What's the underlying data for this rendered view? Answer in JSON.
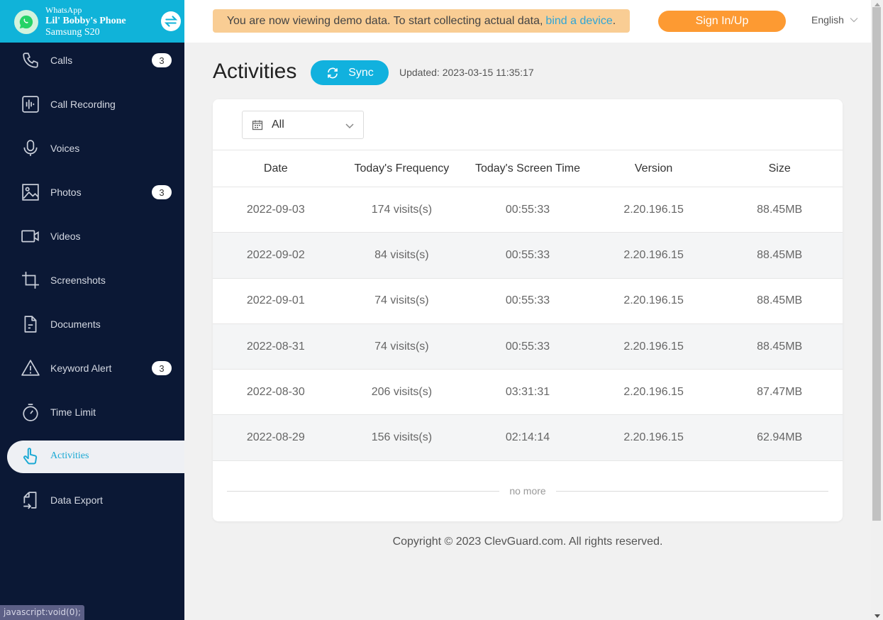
{
  "device": {
    "app": "WhatsApp",
    "name": "Lil' Bobby's Phone",
    "model": "Samsung S20",
    "accent_color": "#10b3d9"
  },
  "sidebar": {
    "items": [
      {
        "label": "Calls",
        "icon": "phone-icon",
        "badge": "3"
      },
      {
        "label": "Call Recording",
        "icon": "call-recording-icon",
        "badge": null
      },
      {
        "label": "Voices",
        "icon": "microphone-icon",
        "badge": null
      },
      {
        "label": "Photos",
        "icon": "photo-icon",
        "badge": "3"
      },
      {
        "label": "Videos",
        "icon": "video-camera-icon",
        "badge": null
      },
      {
        "label": "Screenshots",
        "icon": "crop-icon",
        "badge": null
      },
      {
        "label": "Documents",
        "icon": "document-icon",
        "badge": null
      },
      {
        "label": "Keyword Alert",
        "icon": "warning-icon",
        "badge": "3"
      },
      {
        "label": "Time Limit",
        "icon": "stopwatch-icon",
        "badge": null
      },
      {
        "label": "Activities",
        "icon": "hand-pointer-icon",
        "badge": null,
        "active": true
      },
      {
        "label": "Data Export",
        "icon": "export-icon",
        "badge": null
      }
    ],
    "status_tooltip": "javascript:void(0);"
  },
  "topbar": {
    "banner_text": "You are now viewing demo data. To start collecting actual data,",
    "banner_link": "bind a device",
    "banner_suffix": ".",
    "signin_label": "Sign In/Up",
    "language": "English"
  },
  "main": {
    "title": "Activities",
    "sync_label": "Sync",
    "updated": "Updated: 2023-03-15 11:35:17",
    "filter_value": "All",
    "columns": [
      "Date",
      "Today's Frequency",
      "Today's Screen Time",
      "Version",
      "Size"
    ],
    "rows": [
      [
        "2022-09-03",
        "174 visits(s)",
        "00:55:33",
        "2.20.196.15",
        "88.45MB"
      ],
      [
        "2022-09-02",
        "84 visits(s)",
        "00:55:33",
        "2.20.196.15",
        "88.45MB"
      ],
      [
        "2022-09-01",
        "74 visits(s)",
        "00:55:33",
        "2.20.196.15",
        "88.45MB"
      ],
      [
        "2022-08-31",
        "74 visits(s)",
        "00:55:33",
        "2.20.196.15",
        "88.45MB"
      ],
      [
        "2022-08-30",
        "206 visits(s)",
        "03:31:31",
        "2.20.196.15",
        "87.47MB"
      ],
      [
        "2022-08-29",
        "156 visits(s)",
        "02:14:14",
        "2.20.196.15",
        "62.94MB"
      ]
    ],
    "no_more": "no more"
  },
  "footer": {
    "copyright": "Copyright © 2023 ClevGuard.com. All rights reserved."
  }
}
